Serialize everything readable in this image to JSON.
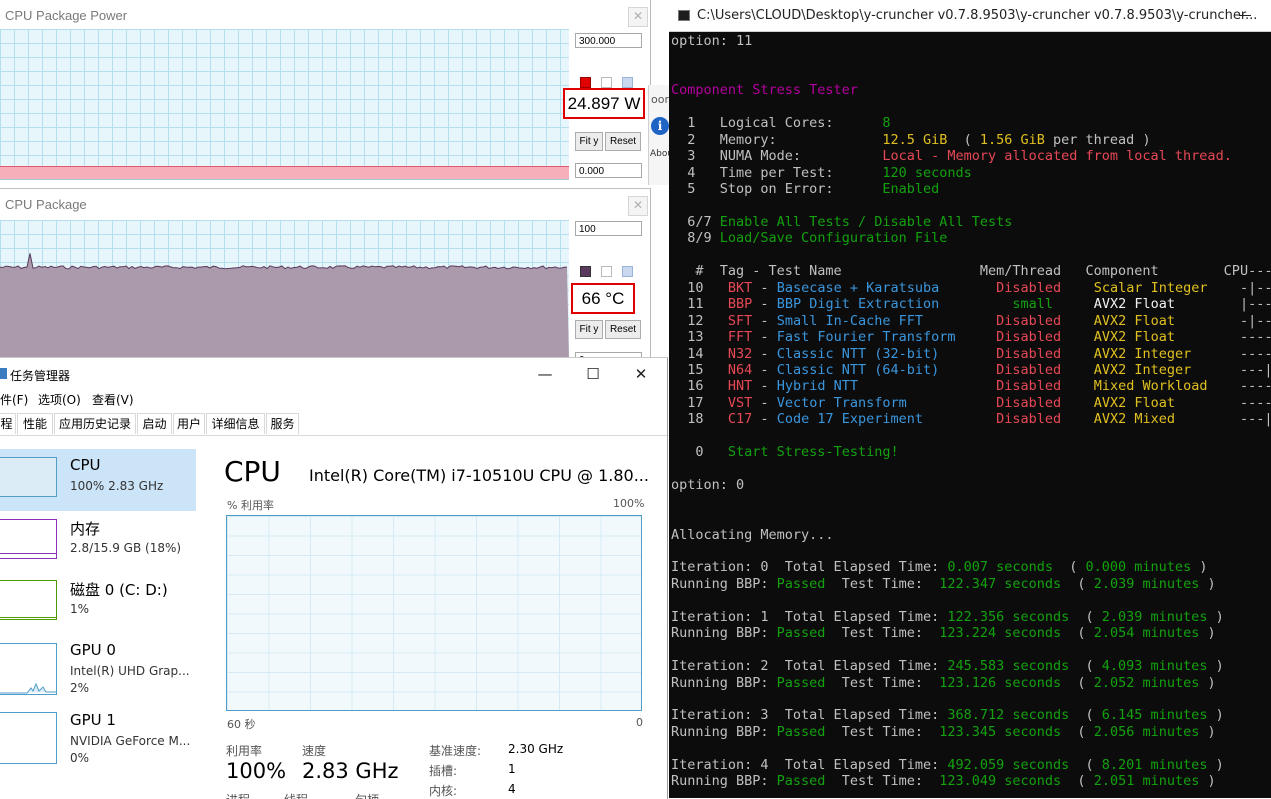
{
  "power_window": {
    "title": "CPU Package Power",
    "max_value": "300.000",
    "min_value": "0.000",
    "readout": "24.897 W",
    "fit_label": "Fit y",
    "reset_label": "Reset",
    "level_fraction": 0.083,
    "colors": {
      "fill": "#f7b0b9",
      "line": "#e05a70",
      "mark_red": "#e00000"
    }
  },
  "temp_window": {
    "title": "CPU Package",
    "max_value": "100",
    "min_value": "0",
    "readout": "66 °C",
    "fit_label": "Fit y",
    "reset_label": "Reset",
    "level_fraction": 0.66,
    "colors": {
      "fill": "#aa9aac",
      "line": "#5a3a5c"
    }
  },
  "behind_window": {
    "fragment_text": "oor",
    "about_label": "Abou"
  },
  "taskmgr": {
    "title": "任务管理器",
    "menu": [
      "件(F)",
      "选项(O)",
      "查看(V)"
    ],
    "tabs": [
      "程",
      "性能",
      "应用历史记录",
      "启动",
      "用户",
      "详细信息",
      "服务"
    ],
    "active_tab": "性能",
    "sidebar": [
      {
        "name": "CPU",
        "sub": "100%  2.83 GHz",
        "sub2": "",
        "color": "#4f9ec9"
      },
      {
        "name": "内存",
        "sub": "2.8/15.9 GB (18%)",
        "sub2": "",
        "color": "#8b2fb5"
      },
      {
        "name": "磁盘 0 (C: D:)",
        "sub": "1%",
        "sub2": "",
        "color": "#4d9a06"
      },
      {
        "name": "GPU 0",
        "sub": "Intel(R) UHD Grap...",
        "sub2": "2%",
        "color": "#4f9ec9"
      },
      {
        "name": "GPU 1",
        "sub": "NVIDIA GeForce M...",
        "sub2": "0%",
        "color": "#4f9ec9"
      }
    ],
    "heading": "CPU",
    "cpu_model": "Intel(R) Core(TM) i7-10510U CPU @ 1.80...",
    "graph_label": "% 利用率",
    "graph_max": "100%",
    "graph_time": "60 秒",
    "graph_min": "0",
    "utilization_label": "利用率",
    "utilization_value": "100%",
    "speed_label": "速度",
    "speed_value": "2.83 GHz",
    "specs": [
      {
        "label": "基准速度:",
        "value": "2.30 GHz"
      },
      {
        "label": "插槽:",
        "value": "1"
      },
      {
        "label": "内核:",
        "value": "4"
      }
    ],
    "cut_labels": [
      "进程",
      "线程",
      "句柄"
    ]
  },
  "console": {
    "title": "C:\\Users\\CLOUD\\Desktop\\y-cruncher v0.7.8.9503\\y-cruncher v0.7.8.9503\\y-cruncher...",
    "lines": [
      [
        [
          "option: 11",
          "w"
        ]
      ],
      [
        [
          "",
          "w"
        ]
      ],
      [
        [
          "",
          "w"
        ]
      ],
      [
        [
          "Component Stress Tester",
          "m"
        ]
      ],
      [
        [
          "",
          "w"
        ]
      ],
      [
        [
          "  1   Logical Cores:      ",
          "w"
        ],
        [
          "8",
          "g"
        ]
      ],
      [
        [
          "  2   Memory:             ",
          "w"
        ],
        [
          "12.5 GiB",
          "y"
        ],
        [
          "  ( ",
          "w"
        ],
        [
          "1.56 GiB",
          "y"
        ],
        [
          " per thread )",
          "w"
        ]
      ],
      [
        [
          "  3   NUMA Mode:          ",
          "w"
        ],
        [
          "Local - Memory allocated from local thread.",
          "r"
        ]
      ],
      [
        [
          "  4   Time per Test:      ",
          "w"
        ],
        [
          "120 seconds",
          "g"
        ]
      ],
      [
        [
          "  5   Stop on Error:      ",
          "w"
        ],
        [
          "Enabled",
          "g"
        ]
      ],
      [
        [
          "",
          "w"
        ]
      ],
      [
        [
          "  6/7 ",
          "w"
        ],
        [
          "Enable All Tests / Disable All Tests",
          "g"
        ]
      ],
      [
        [
          "  8/9 ",
          "w"
        ],
        [
          "Load/Save Configuration File",
          "g"
        ]
      ],
      [
        [
          "",
          "w"
        ]
      ],
      [
        [
          "   #  Tag - Test Name                 Mem/Thread   Component        CPU------",
          "w"
        ]
      ],
      [
        [
          "  10   ",
          "w"
        ],
        [
          "BKT",
          "r"
        ],
        [
          " - ",
          "w"
        ],
        [
          "Basecase + Karatsuba",
          "b"
        ],
        [
          "       ",
          "w"
        ],
        [
          "Disabled",
          "r"
        ],
        [
          "    ",
          "w"
        ],
        [
          "Scalar Integer",
          "y"
        ],
        [
          "    -|-------",
          "w"
        ]
      ],
      [
        [
          "  11   ",
          "w"
        ],
        [
          "BBP",
          "r"
        ],
        [
          " - ",
          "w"
        ],
        [
          "BBP Digit Extraction",
          "b"
        ],
        [
          "         ",
          "w"
        ],
        [
          "small",
          "g"
        ],
        [
          "     ",
          "w"
        ],
        [
          "AVX2 Float",
          "wt"
        ],
        [
          "        |--------",
          "w"
        ]
      ],
      [
        [
          "  12   ",
          "w"
        ],
        [
          "SFT",
          "r"
        ],
        [
          " - ",
          "w"
        ],
        [
          "Small In-Cache FFT",
          "b"
        ],
        [
          "         ",
          "w"
        ],
        [
          "Disabled",
          "r"
        ],
        [
          "    ",
          "w"
        ],
        [
          "AVX2 Float",
          "y"
        ],
        [
          "        -|-------",
          "w"
        ]
      ],
      [
        [
          "  13   ",
          "w"
        ],
        [
          "FFT",
          "r"
        ],
        [
          " - ",
          "w"
        ],
        [
          "Fast Fourier Transform",
          "b"
        ],
        [
          "     ",
          "w"
        ],
        [
          "Disabled",
          "r"
        ],
        [
          "    ",
          "w"
        ],
        [
          "AVX2 Float",
          "y"
        ],
        [
          "        ---------",
          "w"
        ]
      ],
      [
        [
          "  14   ",
          "w"
        ],
        [
          "N32",
          "r"
        ],
        [
          " - ",
          "w"
        ],
        [
          "Classic NTT (32-bit)",
          "b"
        ],
        [
          "       ",
          "w"
        ],
        [
          "Disabled",
          "r"
        ],
        [
          "    ",
          "w"
        ],
        [
          "AVX2 Integer",
          "y"
        ],
        [
          "      -----|---",
          "w"
        ]
      ],
      [
        [
          "  15   ",
          "w"
        ],
        [
          "N64",
          "r"
        ],
        [
          " - ",
          "w"
        ],
        [
          "Classic NTT (64-bit)",
          "b"
        ],
        [
          "       ",
          "w"
        ],
        [
          "Disabled",
          "r"
        ],
        [
          "    ",
          "w"
        ],
        [
          "AVX2 Integer",
          "y"
        ],
        [
          "      ---|-----",
          "w"
        ]
      ],
      [
        [
          "  16   ",
          "w"
        ],
        [
          "HNT",
          "r"
        ],
        [
          " - ",
          "w"
        ],
        [
          "Hybrid NTT",
          "b"
        ],
        [
          "                 ",
          "w"
        ],
        [
          "Disabled",
          "r"
        ],
        [
          "    ",
          "w"
        ],
        [
          "Mixed Workload",
          "y"
        ],
        [
          "    ----|----",
          "w"
        ]
      ],
      [
        [
          "  17   ",
          "w"
        ],
        [
          "VST",
          "r"
        ],
        [
          " - ",
          "w"
        ],
        [
          "Vector Transform",
          "b"
        ],
        [
          "           ",
          "w"
        ],
        [
          "Disabled",
          "r"
        ],
        [
          "    ",
          "w"
        ],
        [
          "AVX2 Float",
          "y"
        ],
        [
          "        -----|---",
          "w"
        ]
      ],
      [
        [
          "  18   ",
          "w"
        ],
        [
          "C17",
          "r"
        ],
        [
          " - ",
          "w"
        ],
        [
          "Code 17 Experiment",
          "b"
        ],
        [
          "         ",
          "w"
        ],
        [
          "Disabled",
          "r"
        ],
        [
          "    ",
          "w"
        ],
        [
          "AVX2 Mixed",
          "y"
        ],
        [
          "        ---|-----",
          "w"
        ]
      ],
      [
        [
          "",
          "w"
        ]
      ],
      [
        [
          "   0   ",
          "w"
        ],
        [
          "Start Stress-Testing!",
          "g"
        ]
      ],
      [
        [
          "",
          "w"
        ]
      ],
      [
        [
          "option: 0",
          "w"
        ]
      ],
      [
        [
          "",
          "w"
        ]
      ],
      [
        [
          "",
          "w"
        ]
      ],
      [
        [
          "Allocating Memory...",
          "w"
        ]
      ],
      [
        [
          "",
          "w"
        ]
      ],
      [
        [
          "Iteration: 0  Total Elapsed Time: ",
          "w"
        ],
        [
          "0.007 seconds",
          "g"
        ],
        [
          "  ( ",
          "w"
        ],
        [
          "0.000 minutes",
          "g"
        ],
        [
          " )",
          "w"
        ]
      ],
      [
        [
          "Running BBP: ",
          "w"
        ],
        [
          "Passed",
          "g"
        ],
        [
          "  Test Time:  ",
          "w"
        ],
        [
          "122.347 seconds",
          "g"
        ],
        [
          "  ( ",
          "w"
        ],
        [
          "2.039 minutes",
          "g"
        ],
        [
          " )",
          "w"
        ]
      ],
      [
        [
          "",
          "w"
        ]
      ],
      [
        [
          "Iteration: 1  Total Elapsed Time: ",
          "w"
        ],
        [
          "122.356 seconds",
          "g"
        ],
        [
          "  ( ",
          "w"
        ],
        [
          "2.039 minutes",
          "g"
        ],
        [
          " )",
          "w"
        ]
      ],
      [
        [
          "Running BBP: ",
          "w"
        ],
        [
          "Passed",
          "g"
        ],
        [
          "  Test Time:  ",
          "w"
        ],
        [
          "123.224 seconds",
          "g"
        ],
        [
          "  ( ",
          "w"
        ],
        [
          "2.054 minutes",
          "g"
        ],
        [
          " )",
          "w"
        ]
      ],
      [
        [
          "",
          "w"
        ]
      ],
      [
        [
          "Iteration: 2  Total Elapsed Time: ",
          "w"
        ],
        [
          "245.583 seconds",
          "g"
        ],
        [
          "  ( ",
          "w"
        ],
        [
          "4.093 minutes",
          "g"
        ],
        [
          " )",
          "w"
        ]
      ],
      [
        [
          "Running BBP: ",
          "w"
        ],
        [
          "Passed",
          "g"
        ],
        [
          "  Test Time:  ",
          "w"
        ],
        [
          "123.126 seconds",
          "g"
        ],
        [
          "  ( ",
          "w"
        ],
        [
          "2.052 minutes",
          "g"
        ],
        [
          " )",
          "w"
        ]
      ],
      [
        [
          "",
          "w"
        ]
      ],
      [
        [
          "Iteration: 3  Total Elapsed Time: ",
          "w"
        ],
        [
          "368.712 seconds",
          "g"
        ],
        [
          "  ( ",
          "w"
        ],
        [
          "6.145 minutes",
          "g"
        ],
        [
          " )",
          "w"
        ]
      ],
      [
        [
          "Running BBP: ",
          "w"
        ],
        [
          "Passed",
          "g"
        ],
        [
          "  Test Time:  ",
          "w"
        ],
        [
          "123.345 seconds",
          "g"
        ],
        [
          "  ( ",
          "w"
        ],
        [
          "2.056 minutes",
          "g"
        ],
        [
          " )",
          "w"
        ]
      ],
      [
        [
          "",
          "w"
        ]
      ],
      [
        [
          "Iteration: 4  Total Elapsed Time: ",
          "w"
        ],
        [
          "492.059 seconds",
          "g"
        ],
        [
          "  ( ",
          "w"
        ],
        [
          "8.201 minutes",
          "g"
        ],
        [
          " )",
          "w"
        ]
      ],
      [
        [
          "Running BBP: ",
          "w"
        ],
        [
          "Passed",
          "g"
        ],
        [
          "  Test Time:  ",
          "w"
        ],
        [
          "123.049 seconds",
          "g"
        ],
        [
          "  ( ",
          "w"
        ],
        [
          "2.051 minutes",
          "g"
        ],
        [
          " )",
          "w"
        ]
      ]
    ]
  }
}
